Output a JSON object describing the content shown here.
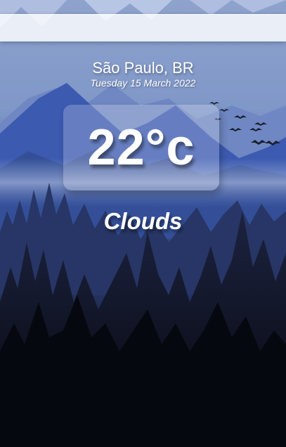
{
  "search": {
    "placeholder": "",
    "value": ""
  },
  "location": "São Paulo, BR",
  "date": "Tuesday 15 March 2022",
  "temperature": "22°c",
  "condition": "Clouds",
  "background": {
    "scene": "misty blue mountains with pine forest and flying birds"
  },
  "colors": {
    "sky_top": "#9bb0d8",
    "mountain_blue": "#3f5fb0",
    "forest_dark": "#0b0f1c",
    "text": "#ffffff"
  }
}
